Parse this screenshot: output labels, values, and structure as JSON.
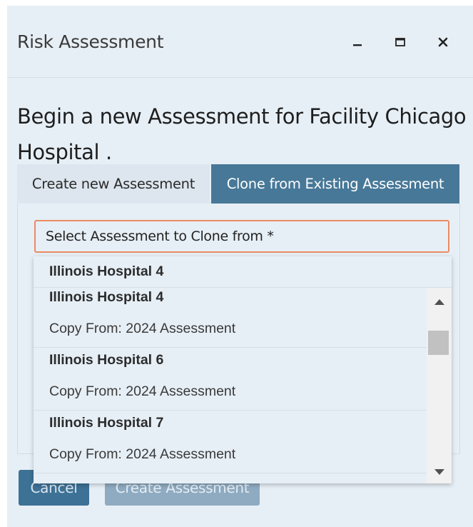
{
  "window": {
    "title": "Risk Assessment",
    "minimize_icon": "minimize-icon",
    "maximize_icon": "maximize-icon",
    "close_icon": "close-icon"
  },
  "heading": {
    "line1": "Begin a new Assessment for Facility Chicago",
    "line2": "Hospital ."
  },
  "tabs": [
    {
      "label": "Create new Assessment",
      "active": false
    },
    {
      "label": "Clone from Existing Assessment",
      "active": true
    }
  ],
  "select": {
    "placeholder": "Select Assessment to Clone from *"
  },
  "dropdown": {
    "group_header": "Illinois Hospital 4",
    "items": [
      {
        "name": "Illinois Hospital 4",
        "sub": "Copy From: 2024 Assessment"
      },
      {
        "name": "Illinois Hospital 6",
        "sub": "Copy From: 2024 Assessment"
      },
      {
        "name": "Illinois Hospital 7",
        "sub": "Copy From: 2024 Assessment"
      }
    ]
  },
  "footer": {
    "cancel_label": "Cancel",
    "create_label": "Create Assessment"
  },
  "colors": {
    "accent": "#477898",
    "focus_border": "#e98b63",
    "background": "#e7eff6"
  }
}
